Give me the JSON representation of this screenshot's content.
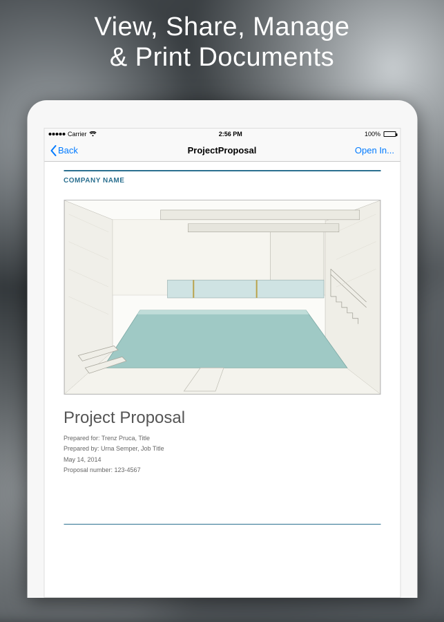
{
  "promo": {
    "line1": "View, Share, Manage",
    "line2": "& Print Documents"
  },
  "status_bar": {
    "carrier": "Carrier",
    "time": "2:56 PM",
    "battery_pct": "100%"
  },
  "nav": {
    "back_label": "Back",
    "title": "ProjectProposal",
    "action_label": "Open In..."
  },
  "document": {
    "company_label": "COMPANY NAME",
    "title": "Project Proposal",
    "prepared_for": "Prepared for: Trenz Pruca, Title",
    "prepared_by": "Prepared by: Urna Semper, Job Title",
    "date": "May 14, 2014",
    "proposal_number": "Proposal number: 123-4567"
  }
}
